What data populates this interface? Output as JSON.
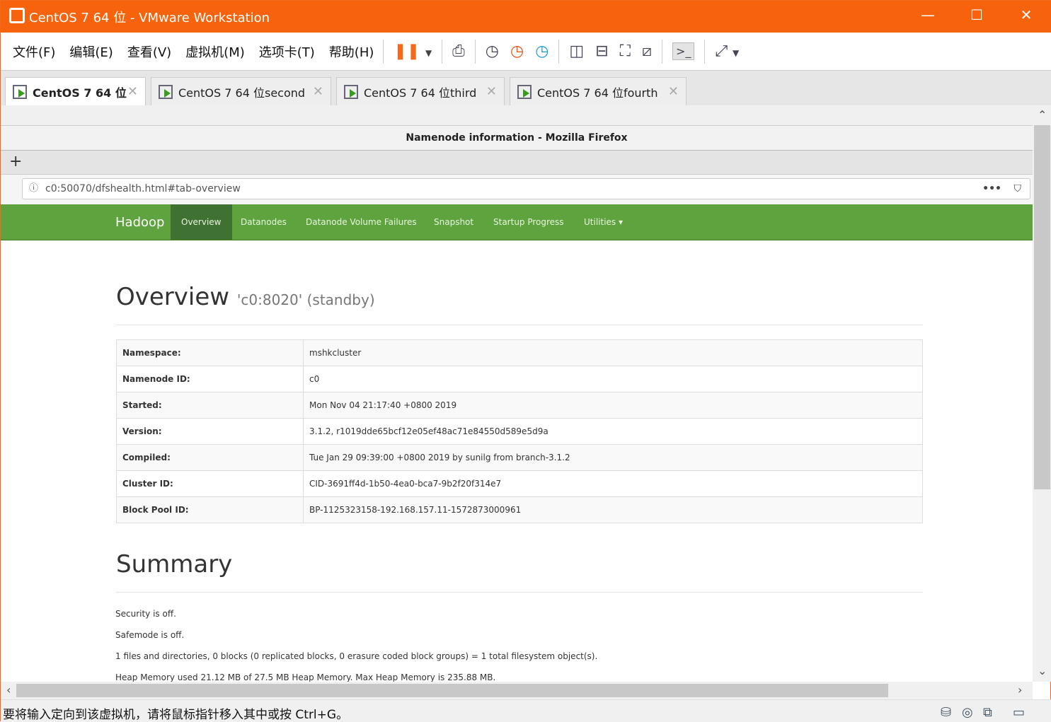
{
  "window": {
    "title": "CentOS 7 64 位 - VMware Workstation"
  },
  "menu": [
    "文件(F)",
    "编辑(E)",
    "查看(V)",
    "虚拟机(M)",
    "选项卡(T)",
    "帮助(H)"
  ],
  "vm_tabs": [
    "CentOS 7 64 位",
    "CentOS 7 64 位second",
    "CentOS 7 64 位third",
    "CentOS 7 64 位fourth"
  ],
  "firefox": {
    "title": "Namenode information - Mozilla Firefox",
    "url": "c0:50070/dfshealth.html#tab-overview"
  },
  "hadoop": {
    "brand": "Hadoop",
    "nav": [
      "Overview",
      "Datanodes",
      "Datanode Volume Failures",
      "Snapshot",
      "Startup Progress",
      "Utilities ▾"
    ]
  },
  "overview": {
    "title": "Overview",
    "subtitle": "'c0:8020' (standby)",
    "rows": [
      {
        "k": "Namespace:",
        "v": "mshkcluster"
      },
      {
        "k": "Namenode ID:",
        "v": "c0"
      },
      {
        "k": "Started:",
        "v": "Mon Nov 04 21:17:40 +0800 2019"
      },
      {
        "k": "Version:",
        "v": "3.1.2, r1019dde65bcf12e05ef48ac71e84550d589e5d9a"
      },
      {
        "k": "Compiled:",
        "v": "Tue Jan 29 09:39:00 +0800 2019 by sunilg from branch-3.1.2"
      },
      {
        "k": "Cluster ID:",
        "v": "CID-3691ff4d-1b50-4ea0-bca7-9b2f20f314e7"
      },
      {
        "k": "Block Pool ID:",
        "v": "BP-1125323158-192.168.157.11-1572873000961"
      }
    ]
  },
  "summary": {
    "title": "Summary",
    "lines": [
      "Security is off.",
      "Safemode is off.",
      "1 files and directories, 0 blocks (0 replicated blocks, 0 erasure coded block groups) = 1 total filesystem object(s).",
      "Heap Memory used 21.12 MB of 27.5 MB Heap Memory. Max Heap Memory is 235.88 MB."
    ]
  },
  "status": "要将输入定向到该虚拟机，请将鼠标指针移入其中或按 Ctrl+G。",
  "colors": {
    "titlebar": "#f7630c",
    "hadoop_nav": "#5fa33e"
  }
}
